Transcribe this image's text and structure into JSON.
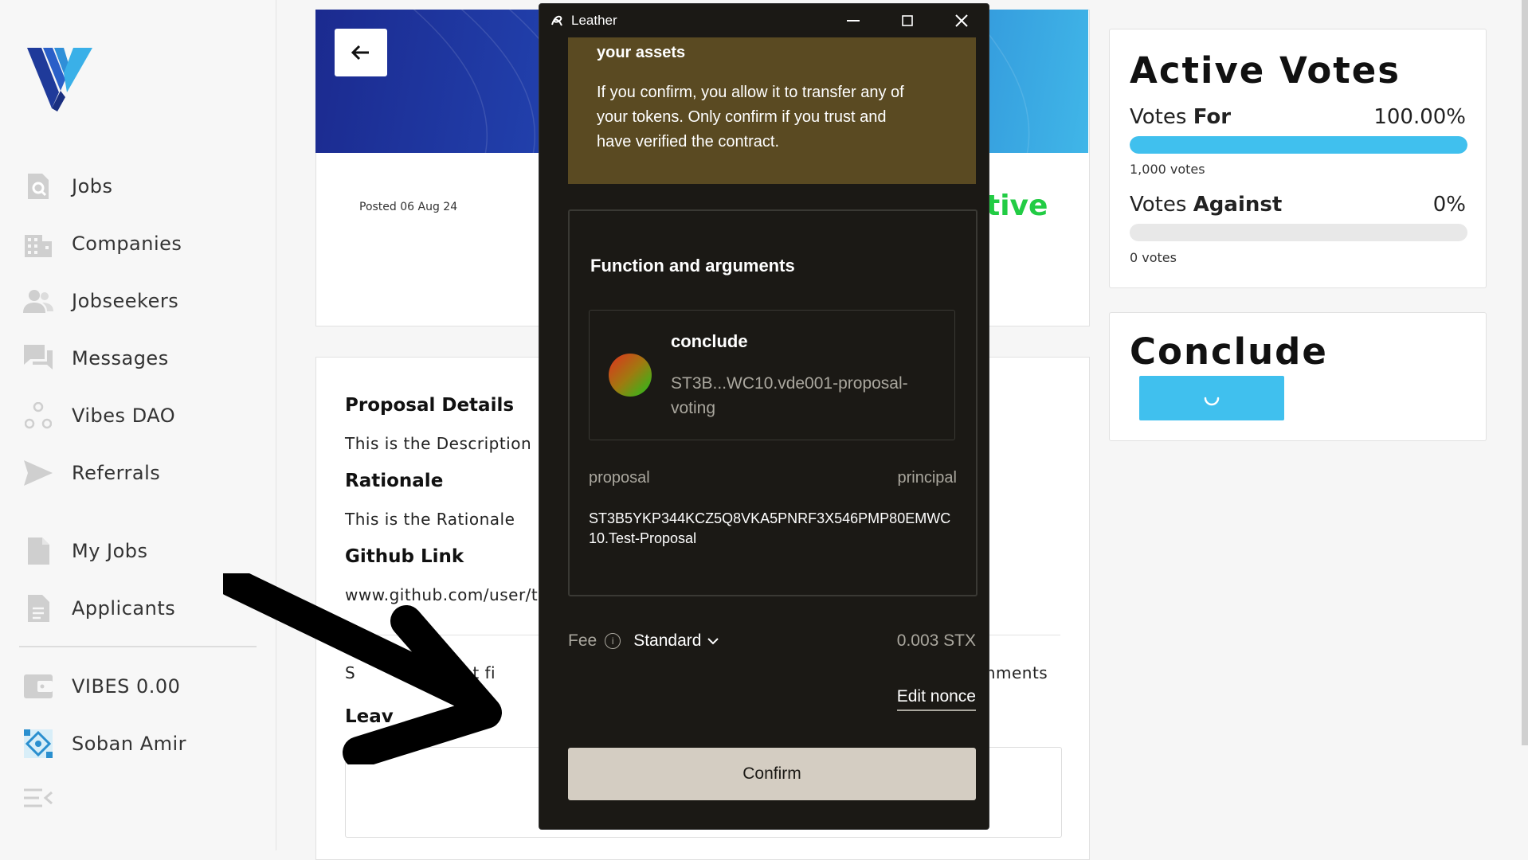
{
  "sidebar": {
    "items": [
      {
        "label": "Jobs",
        "icon": "search-document-icon"
      },
      {
        "label": "Companies",
        "icon": "building-icon"
      },
      {
        "label": "Jobseekers",
        "icon": "users-icon"
      },
      {
        "label": "Messages",
        "icon": "chat-icon"
      },
      {
        "label": "Vibes DAO",
        "icon": "dao-icon"
      },
      {
        "label": "Referrals",
        "icon": "send-icon"
      },
      {
        "label": "My Jobs",
        "icon": "document-icon"
      },
      {
        "label": "Applicants",
        "icon": "list-document-icon"
      },
      {
        "label": "VIBES 0.00",
        "icon": "wallet-icon"
      },
      {
        "label": "Soban Amir",
        "icon": "avatar"
      }
    ]
  },
  "proposal": {
    "posted": "Posted 06 Aug 24",
    "status_fragment": "tive",
    "details_title": "Proposal Details",
    "description": "This is the Description",
    "rationale_title": "Rationale",
    "rationale": "This is the Rationale",
    "github_title": "Github Link",
    "github": "www.github.com/user/t",
    "recent_fragment": "S        m  recent fi",
    "comments_fragment": "mments",
    "leave_fragment": "Leav               t"
  },
  "votes": {
    "title": "Active Votes",
    "for_label_prefix": "Votes ",
    "for_label_strong": "For",
    "for_pct": "100.00%",
    "for_fill": 1.0,
    "for_count": "1,000 votes",
    "against_label_prefix": "Votes ",
    "against_label_strong": "Against",
    "against_pct": "0%",
    "against_fill": 0.0,
    "against_count": "0 votes"
  },
  "conclude": {
    "title": "Conclude"
  },
  "modal": {
    "window_title": "Leather",
    "warning_head": "your assets",
    "warning_body": "If you confirm, you allow it to transfer any of your tokens. Only confirm if you trust and have verified the contract.",
    "fa_title": "Function and arguments",
    "function_name": "conclude",
    "contract": "ST3B...WC10.vde001-proposal-voting",
    "arg_name": "proposal",
    "arg_type": "principal",
    "arg_value": "ST3B5YKP344KCZ5Q8VKA5PNRF3X546PMP80EMWC10.Test-Proposal",
    "fee_label": "Fee",
    "fee_speed": "Standard",
    "fee_amount": "0.003 STX",
    "edit_nonce": "Edit nonce",
    "confirm": "Confirm"
  },
  "colors": {
    "accent": "#40c0ee",
    "active_green": "#22cc44",
    "modal_bg": "#1b1915",
    "warning_bg": "#5a4a22",
    "confirm_bg": "#d4cdc2"
  }
}
